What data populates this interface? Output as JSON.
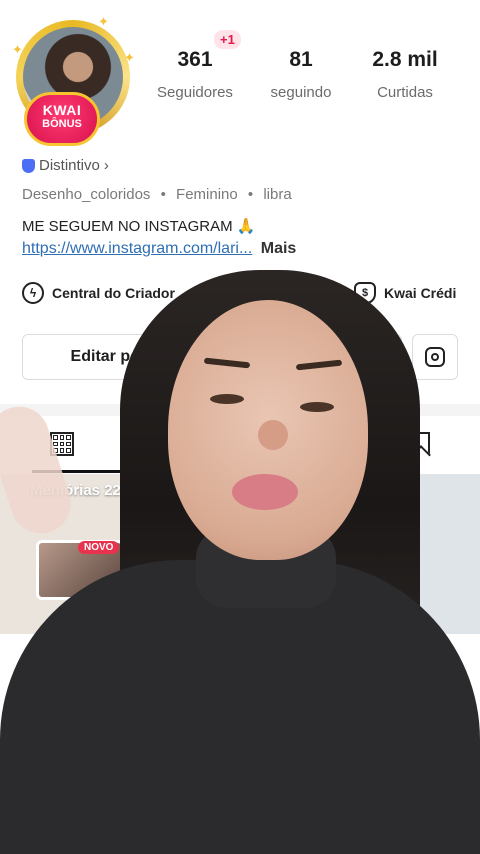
{
  "profile": {
    "kwai_badge_line1": "KWAI",
    "kwai_badge_line2": "BÔNUS",
    "new_badge": "+1",
    "stats": [
      {
        "value": "361",
        "label": "Seguidores"
      },
      {
        "value": "81",
        "label": "seguindo"
      },
      {
        "value": "2.8 mil",
        "label": "Curtidas"
      }
    ],
    "distintivo": "Distintivo",
    "distintivo_chevron": "›",
    "tags": [
      "Desenho_coloridos",
      "Feminino",
      "libra"
    ],
    "tag_separator": "•",
    "bio": "ME SEGUEM NO INSTAGRAM 🙏",
    "link": "https://www.instagram.com/lari...",
    "more": "Mais"
  },
  "creator_row": {
    "central": "Central do Criador",
    "kwai_credit": "Kwai Crédi"
  },
  "buttons": {
    "edit_profile": "Editar perfil"
  },
  "grid": {
    "memories_label": "Memórias 22",
    "novo": "NOVO"
  },
  "icons": {
    "central": "bolt-icon",
    "credit": "money-bag-icon",
    "instagram": "instagram-icon",
    "grid": "grid-icon",
    "bookmark": "bookmark-icon"
  }
}
